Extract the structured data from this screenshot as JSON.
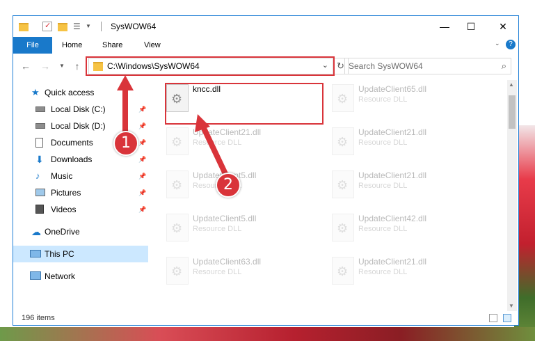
{
  "window": {
    "title": "SysWOW64",
    "minimize": "—",
    "maximize": "☐",
    "close": "✕"
  },
  "ribbon": {
    "file": "File",
    "tabs": [
      "Home",
      "Share",
      "View"
    ],
    "help": "?"
  },
  "address": {
    "path": "C:\\Windows\\SysWOW64",
    "search_placeholder": "Search SysWOW64"
  },
  "nav": {
    "items": [
      {
        "label": "Quick access",
        "icon": "star-icon"
      },
      {
        "label": "Local Disk (C:)",
        "icon": "drive-icon",
        "pinned": true
      },
      {
        "label": "Local Disk (D:)",
        "icon": "drive-icon",
        "pinned": true
      },
      {
        "label": "Documents",
        "icon": "documents-icon",
        "pinned": true
      },
      {
        "label": "Downloads",
        "icon": "download-icon",
        "pinned": true
      },
      {
        "label": "Music",
        "icon": "music-icon",
        "pinned": true
      },
      {
        "label": "Pictures",
        "icon": "pictures-icon",
        "pinned": true
      },
      {
        "label": "Videos",
        "icon": "videos-icon",
        "pinned": true
      },
      {
        "label": "OneDrive",
        "icon": "cloud-icon"
      },
      {
        "label": "This PC",
        "icon": "computer-icon",
        "selected": true
      },
      {
        "label": "Network",
        "icon": "network-icon"
      }
    ]
  },
  "files": {
    "left": [
      {
        "name": "kncc.dll",
        "type": ""
      },
      {
        "name": "UpdateClient21.dll",
        "type": "Resource DLL"
      },
      {
        "name": "UpdateClient5.dll",
        "type": "Resource DLL"
      },
      {
        "name": "UpdateClient5.dll",
        "type": "Resource DLL"
      },
      {
        "name": "UpdateClient63.dll",
        "type": "Resource DLL"
      }
    ],
    "right": [
      {
        "name": "UpdateClient65.dll",
        "type": "Resource DLL"
      },
      {
        "name": "UpdateClient21.dll",
        "type": "Resource DLL"
      },
      {
        "name": "UpdateClient21.dll",
        "type": "Resource DLL"
      },
      {
        "name": "UpdateClient42.dll",
        "type": "Resource DLL"
      },
      {
        "name": "UpdateClient21.dll",
        "type": "Resource DLL"
      }
    ]
  },
  "status": {
    "count": "196 items"
  },
  "callouts": [
    "1",
    "2"
  ],
  "colors": {
    "accent": "#1979ca",
    "highlight": "#d9343a",
    "selected": "#cce8ff"
  }
}
